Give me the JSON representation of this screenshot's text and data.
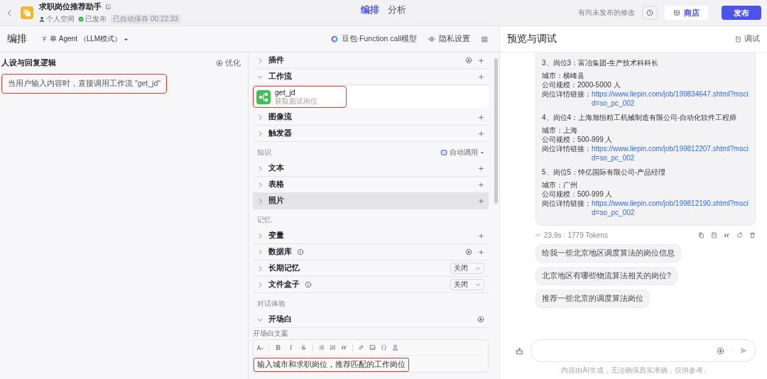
{
  "header": {
    "title": "求职岗位推荐助手",
    "space": "个人空间",
    "status": "已发布",
    "autosave": "已自动保存 00:22:33",
    "tabs": [
      {
        "label": "编排",
        "selected": true
      },
      {
        "label": "分析",
        "selected": false
      }
    ],
    "unpublished_note": "有尚未发布的修改",
    "store_button": "商店",
    "publish_button": "发布"
  },
  "toolbar": {
    "title": "编排",
    "agent_mode": "单 Agent （LLM模式）",
    "model": "豆包·Function call模型",
    "privacy": "隐私设置"
  },
  "persona": {
    "title": "人设与回复逻辑",
    "optimize": "优化",
    "prompt": "当用户输入内容时，直接调用工作流 \"get_jd\"",
    "highlighted": true
  },
  "skills": {
    "groups": [
      {
        "items": [
          {
            "name": "插件",
            "kind": "auto-add",
            "expanded": false,
            "hovered": false,
            "info": false
          },
          {
            "name": "工作流",
            "kind": "add",
            "expanded": true,
            "hovered": false,
            "info": false,
            "children": [
              {
                "name": "get_jd",
                "description": "获取面试岗位",
                "highlighted": true
              }
            ]
          },
          {
            "name": "图像流",
            "kind": "add",
            "expanded": false,
            "hovered": false,
            "info": false
          },
          {
            "name": "触发器",
            "kind": "add",
            "expanded": false,
            "hovered": false,
            "info": false
          }
        ]
      },
      {
        "label": "知识",
        "auto_call": "自动调用",
        "items": [
          {
            "name": "文本",
            "kind": "add",
            "expanded": false,
            "hovered": false,
            "info": false
          },
          {
            "name": "表格",
            "kind": "add",
            "expanded": false,
            "hovered": false,
            "info": false
          },
          {
            "name": "照片",
            "kind": "add",
            "expanded": false,
            "hovered": true,
            "info": false
          }
        ]
      },
      {
        "label": "记忆",
        "items": [
          {
            "name": "变量",
            "kind": "add",
            "expanded": false,
            "hovered": false,
            "info": false
          },
          {
            "name": "数据库",
            "kind": "auto-add",
            "expanded": false,
            "hovered": false,
            "info": true
          },
          {
            "name": "长期记忆",
            "kind": "select",
            "value": "关闭",
            "expanded": false,
            "hovered": false,
            "info": false
          },
          {
            "name": "文件盒子",
            "kind": "select",
            "value": "关闭",
            "expanded": false,
            "hovered": false,
            "info": true
          }
        ]
      },
      {
        "label": "对话体验",
        "items": [
          {
            "name": "开场白",
            "kind": "auto",
            "expanded": true,
            "hovered": false,
            "info": false
          }
        ]
      }
    ]
  },
  "opening": {
    "label": "开场白文案",
    "format_buttons": [
      "B",
      "I",
      "S"
    ],
    "text": "输入城市和求职岗位，推荐匹配的工作岗位",
    "highlighted": true
  },
  "preview": {
    "title": "预览与调试",
    "debug": "调试",
    "jobs": [
      {
        "heading": "3、岗位3：富冶集团-生产技术科科长",
        "lines": [
          {
            "kind": "text",
            "text": "城市：横峰县"
          },
          {
            "kind": "text",
            "text": "公司规模：2000-5000 人"
          },
          {
            "kind": "link",
            "label": "岗位详情链接：",
            "url": "https://www.liepin.com/job/199834647.shtml?mscid=so_pc_002"
          }
        ]
      },
      {
        "heading": "4、岗位4：上海旭恒精工机械制造有限公司-自动化软件工程师",
        "lines": [
          {
            "kind": "text",
            "text": "城市：上海"
          },
          {
            "kind": "text",
            "text": "公司规模：500-999 人"
          },
          {
            "kind": "link",
            "label": "岗位详情链接：",
            "url": "https://www.liepin.com/job/199812207.shtml?mscid=so_pc_002"
          }
        ]
      },
      {
        "heading": "5、岗位5：悼亿国际有限公司-产品经理",
        "lines": [
          {
            "kind": "text",
            "text": "城市：广州"
          },
          {
            "kind": "text",
            "text": "公司规模：500-999 人"
          },
          {
            "kind": "link",
            "label": "岗位详情链接：",
            "url": "https://www.liepin.com/job/199812190.shtml?mscid=so_pc_002"
          }
        ]
      }
    ],
    "duration": "23.9s",
    "tokens": "1779 Tokens",
    "suggestions": [
      "给我一些北京地区调度算法的岗位信息",
      "北京地区有哪些物流算法相关的岗位?",
      "推荐一些北京的调度算法岗位"
    ],
    "disclaimer": "内容由AI生成，无法确保真实准确，仅供参考。"
  }
}
